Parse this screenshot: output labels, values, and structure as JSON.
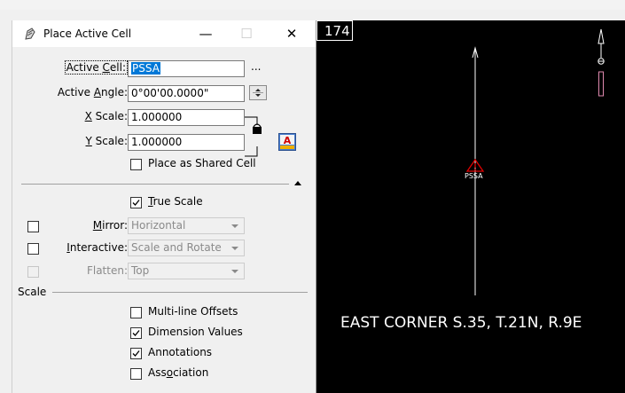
{
  "dialog": {
    "title": "Place Active Cell",
    "title_buttons": {
      "minimize": "—",
      "maximize": "☐",
      "close": "✕"
    },
    "active_cell": {
      "label": "Active Cell:",
      "value": "PSSA",
      "browse": "..."
    },
    "active_angle": {
      "label": "Active Angle:",
      "value": "0°00'00.0000\""
    },
    "x_scale": {
      "label": "X Scale:",
      "value": "1.000000"
    },
    "y_scale": {
      "label": "Y Scale:",
      "value": "1.000000"
    },
    "place_as_shared": {
      "label": "Place as Shared Cell",
      "checked": false
    },
    "true_scale": {
      "label": "True Scale",
      "checked": true
    },
    "mirror": {
      "label": "Mirror:",
      "value": "Horizontal",
      "checked": false
    },
    "interactive": {
      "label": "Interactive:",
      "value": "Scale and Rotate",
      "checked": false
    },
    "flatten": {
      "label": "Flatten:",
      "value": "Top",
      "checked": false
    },
    "scale_section": {
      "label": "Scale"
    },
    "options": [
      {
        "label": "Multi-line Offsets",
        "checked": false
      },
      {
        "label": "Dimension Values",
        "checked": true
      },
      {
        "label": "Annotations",
        "checked": true
      },
      {
        "label": "Association",
        "checked": false
      }
    ]
  },
  "view": {
    "number": "174",
    "cell_label": "PSSA",
    "caption": "EAST CORNER S.35, T.21N, R.9E"
  },
  "colors": {
    "accent": "#0078d7",
    "view_bg": "#000000",
    "cell_red": "#e00000"
  }
}
